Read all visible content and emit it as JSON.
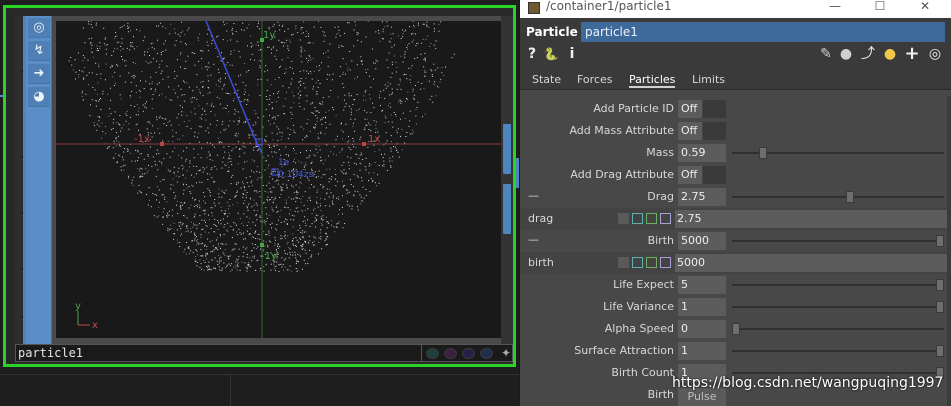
{
  "network": {
    "node_name": "particle1",
    "viewport_icons": [
      {
        "icon": "target-icon",
        "glyph": "◎"
      },
      {
        "icon": "graph-icon",
        "glyph": "↯"
      },
      {
        "icon": "arrow-right-icon",
        "glyph": "➜"
      },
      {
        "icon": "camera-icon",
        "glyph": "◕"
      }
    ],
    "axes_labels": {
      "plus_y": "1y",
      "minus_y": "-1y",
      "minus_x": "-1x",
      "plus_x": "1x",
      "small_a": "1e",
      "small_b": "0.104zs"
    },
    "corner_axes": {
      "y": "y",
      "x": "x"
    },
    "flag_colors": [
      "#1f3f3f",
      "#3f1f3f",
      "#2a1f4a",
      "#1f2f4f"
    ],
    "accent": "#28d428"
  },
  "params": {
    "window_path": "/container1/particle1",
    "window_buttons": [
      "—",
      "☐",
      "✕"
    ],
    "op_type": "Particle",
    "op_name": "particle1",
    "header_icons": [
      {
        "name": "help-icon",
        "glyph": "?"
      },
      {
        "name": "python-help-icon",
        "glyph": "🐍"
      },
      {
        "name": "info-icon",
        "glyph": "i"
      },
      {
        "name": "pencil-icon",
        "glyph": "✎"
      },
      {
        "name": "comment-icon",
        "glyph": "●"
      },
      {
        "name": "bookmark-icon",
        "glyph": "⤴"
      },
      {
        "name": "python-icon",
        "glyph": "●"
      },
      {
        "name": "add-icon",
        "glyph": "+"
      },
      {
        "name": "target-icon",
        "glyph": "◎"
      }
    ],
    "tabs": [
      "State",
      "Forces",
      "Particles",
      "Limits"
    ],
    "active_tab": "Particles",
    "rows": {
      "add_particle_id": {
        "label": "Add Particle ID",
        "value": "Off"
      },
      "add_mass_attr": {
        "label": "Add Mass Attribute",
        "value": "Off"
      },
      "mass": {
        "label": "Mass",
        "value": "0.59",
        "fraction": 0.13
      },
      "add_drag_attr": {
        "label": "Add Drag Attribute",
        "value": "Off"
      },
      "drag": {
        "label": "Drag",
        "value": "2.75",
        "fraction": 0.56
      },
      "drag_chan": {
        "label": "drag",
        "value": "2.75"
      },
      "birth": {
        "label": "Birth",
        "value": "5000",
        "fraction": 1.0
      },
      "birth_chan": {
        "label": "birth",
        "value": "5000"
      },
      "life_expect": {
        "label": "Life Expect",
        "value": "5",
        "fraction": 1.0
      },
      "life_variance": {
        "label": "Life Variance",
        "value": "1",
        "fraction": 1.0
      },
      "alpha_speed": {
        "label": "Alpha Speed",
        "value": "0",
        "fraction": 0.0
      },
      "surface_attraction": {
        "label": "Surface Attraction",
        "value": "1",
        "fraction": 1.0
      },
      "birth_count": {
        "label": "Birth Count",
        "value": "1",
        "fraction": 1.0
      },
      "birth_pulse": {
        "label": "Birth",
        "value": "Pulse"
      }
    },
    "dash_glyph": "—",
    "chip_colors": [
      "#5a5a5a",
      "#5fb0b0",
      "#6fae5f",
      "#a99fd6"
    ]
  },
  "watermark": "https://blog.csdn.net/wangpuqing1997"
}
